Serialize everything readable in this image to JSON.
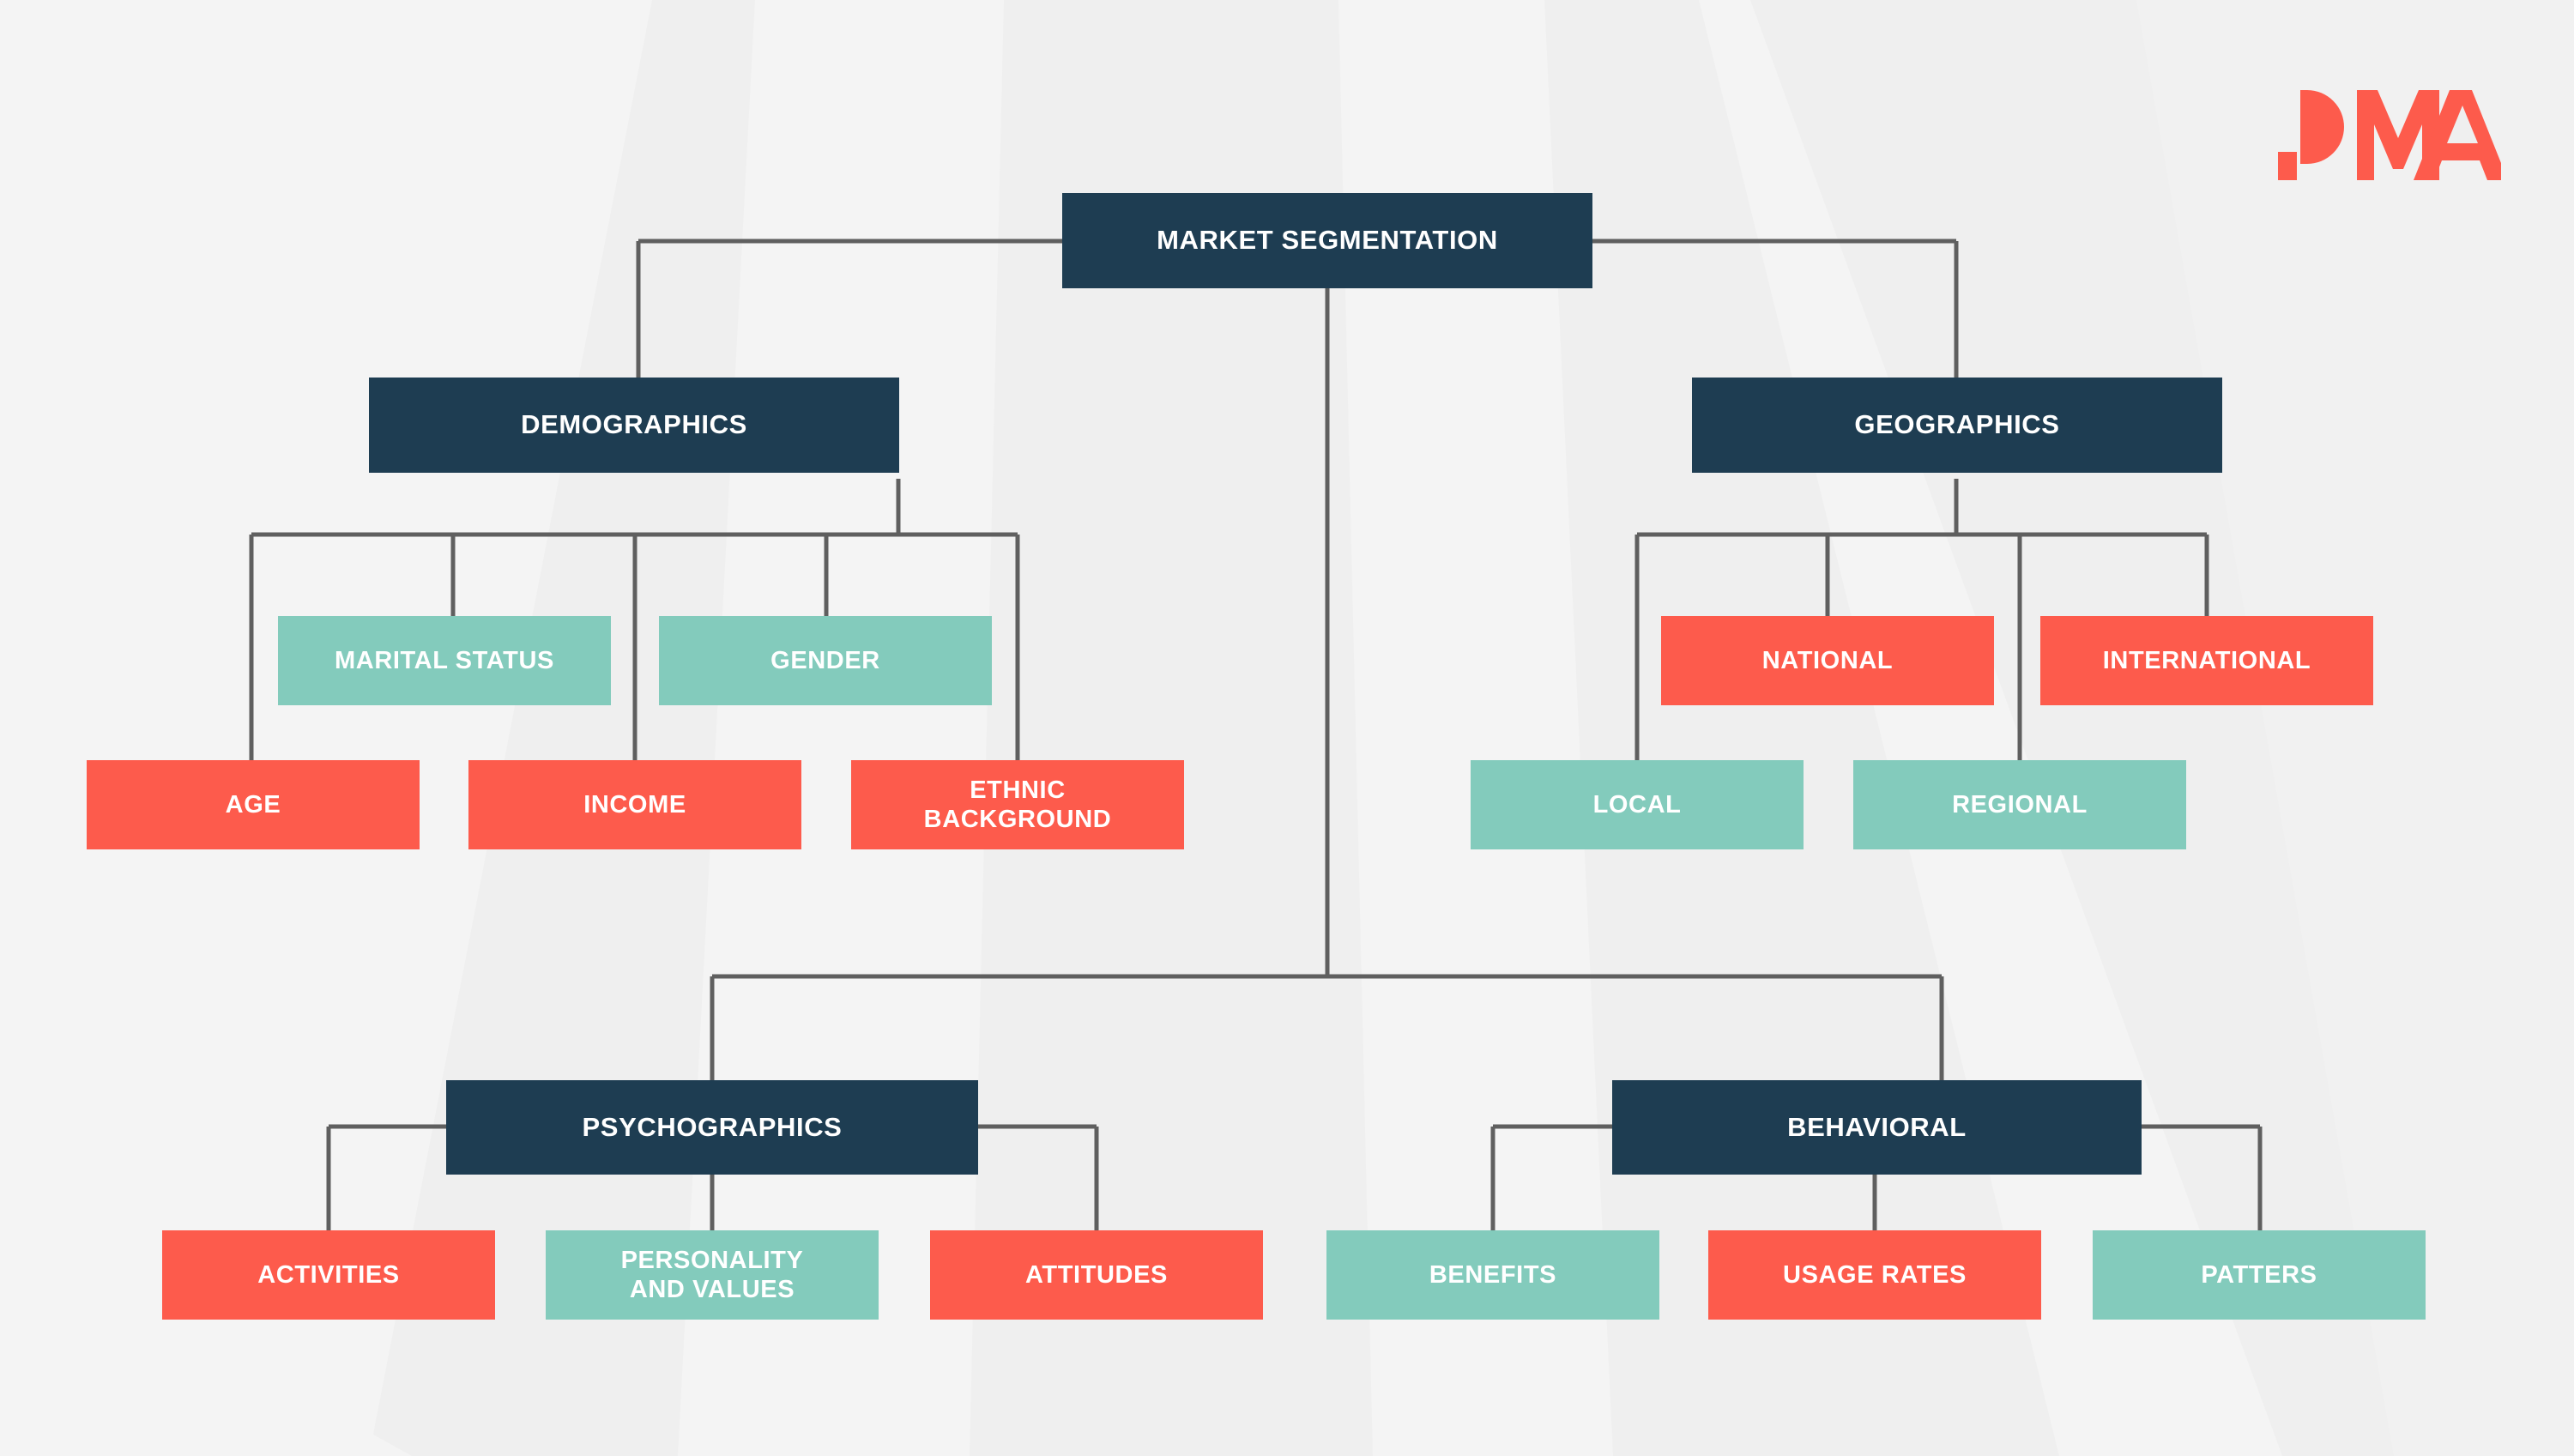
{
  "meta": {
    "diagram_title": "MARKET SEGMENTATION",
    "logo_text": "PMA",
    "colors": {
      "background": "#efefef",
      "navy": "#1e3d52",
      "red": "#fd5b4c",
      "teal": "#83cbbc",
      "connector": "#5f5f5f",
      "logo": "#fd5b4c",
      "label": "#ffffff"
    }
  },
  "nodes": {
    "root": {
      "label": "MARKET SEGMENTATION"
    },
    "demographics": {
      "label": "DEMOGRAPHICS"
    },
    "geographics": {
      "label": "GEOGRAPHICS"
    },
    "psychographics": {
      "label": "PSYCHOGRAPHICS"
    },
    "behavioral": {
      "label": "BEHAVIORAL"
    },
    "marital_status": {
      "label": "MARITAL STATUS"
    },
    "gender": {
      "label": "GENDER"
    },
    "age": {
      "label": "AGE"
    },
    "income": {
      "label": "INCOME"
    },
    "ethnic_background": {
      "label": "ETHNIC\nBACKGROUND"
    },
    "national": {
      "label": "NATIONAL"
    },
    "international": {
      "label": "INTERNATIONAL"
    },
    "local": {
      "label": "LOCAL"
    },
    "regional": {
      "label": "REGIONAL"
    },
    "activities": {
      "label": "ACTIVITIES"
    },
    "personality_and_values": {
      "label": "PERSONALITY\nAND VALUES"
    },
    "attitudes": {
      "label": "ATTITUDES"
    },
    "benefits": {
      "label": "BENEFITS"
    },
    "usage_rates": {
      "label": "USAGE RATES"
    },
    "patters": {
      "label": "PATTERS"
    }
  },
  "chart_data": {
    "type": "diagram",
    "subtype": "hierarchy-tree",
    "title": "MARKET SEGMENTATION",
    "root": "MARKET SEGMENTATION",
    "branches": [
      {
        "name": "DEMOGRAPHICS",
        "color": "navy",
        "children": [
          {
            "name": "AGE",
            "color": "red"
          },
          {
            "name": "MARITAL STATUS",
            "color": "teal"
          },
          {
            "name": "INCOME",
            "color": "red"
          },
          {
            "name": "GENDER",
            "color": "teal"
          },
          {
            "name": "ETHNIC BACKGROUND",
            "color": "red"
          }
        ]
      },
      {
        "name": "GEOGRAPHICS",
        "color": "navy",
        "children": [
          {
            "name": "LOCAL",
            "color": "teal"
          },
          {
            "name": "NATIONAL",
            "color": "red"
          },
          {
            "name": "REGIONAL",
            "color": "teal"
          },
          {
            "name": "INTERNATIONAL",
            "color": "red"
          }
        ]
      },
      {
        "name": "PSYCHOGRAPHICS",
        "color": "navy",
        "children": [
          {
            "name": "ACTIVITIES",
            "color": "red"
          },
          {
            "name": "PERSONALITY AND VALUES",
            "color": "teal"
          },
          {
            "name": "ATTITUDES",
            "color": "red"
          }
        ]
      },
      {
        "name": "BEHAVIORAL",
        "color": "navy",
        "children": [
          {
            "name": "BENEFITS",
            "color": "teal"
          },
          {
            "name": "USAGE RATES",
            "color": "red"
          },
          {
            "name": "PATTERS",
            "color": "teal"
          }
        ]
      }
    ]
  }
}
